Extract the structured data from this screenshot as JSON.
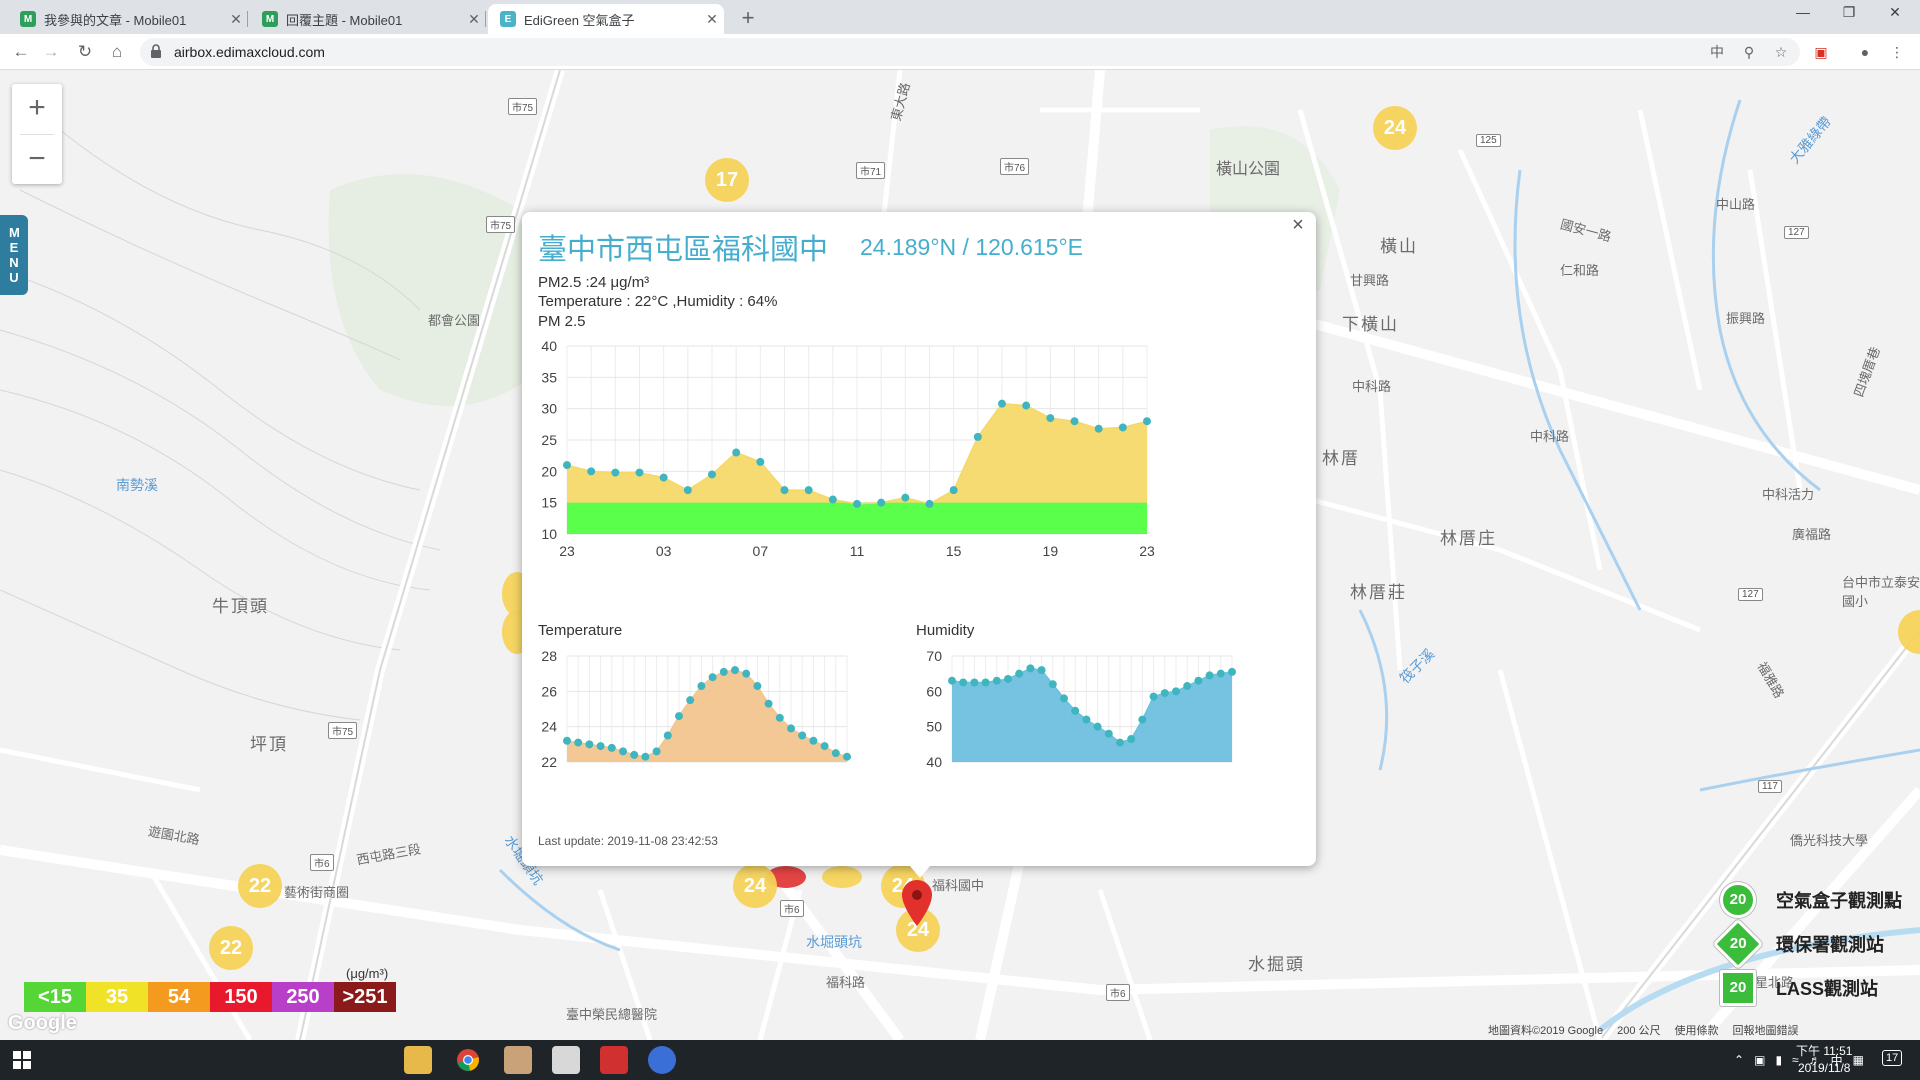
{
  "browser": {
    "tabs": [
      {
        "title": "我參與的文章 - Mobile01",
        "close": "✕"
      },
      {
        "title": "回覆主題 - Mobile01",
        "close": "✕"
      },
      {
        "title": "EdiGreen 空氣盒子",
        "close": "✕"
      }
    ],
    "new_tab": "+",
    "url": "airbox.edimaxcloud.com"
  },
  "map": {
    "zoom_in": "+",
    "zoom_out": "−",
    "menu_label": "MENU",
    "place_labels": [
      "橫山公園",
      "橫山",
      "下橫山",
      "林厝",
      "林厝庄",
      "林厝莊",
      "南勢溪",
      "牛頂頭",
      "坪頂",
      "都會公園",
      "藝術街商圈",
      "水堀頭坑",
      "水掘頭",
      "福科路",
      "中科路",
      "中科路",
      "中科活力",
      "廣福路",
      "台中市立泰安國小",
      "僑光科技大學",
      "福星北路",
      "大雅綠帶",
      "四塊厝巷",
      "臺中榮民總醫院",
      "遊園北路",
      "西屯路三段",
      "福科國中",
      "水堀頭坑",
      "筏子溪",
      "仁和路",
      "振興路",
      "中山路",
      "甘興路",
      "福雅路",
      "國安一路",
      "東大路"
    ],
    "road_tags": [
      "市75",
      "市71",
      "市76",
      "市75",
      "市75",
      "125",
      "127",
      "127",
      "市6",
      "市6",
      "117",
      "市6"
    ],
    "bubbles": [
      "17",
      "24",
      "22",
      "22",
      "24",
      "24",
      "24"
    ]
  },
  "popup": {
    "title": "臺中市西屯區福科國中",
    "coords": "24.189°N / 120.615°E",
    "pm25_line": "PM2.5 :24 μg/m³",
    "temp_hum_line": "Temperature : 22°C ,Humidity : 64%",
    "close": "×",
    "last_update": "Last update: 2019-11-08 23:42:53"
  },
  "chart_data": [
    {
      "type": "area",
      "title": "PM 2.5",
      "x_tick_labels": [
        "23",
        "03",
        "07",
        "11",
        "15",
        "19",
        "23"
      ],
      "ylim": [
        10,
        40
      ],
      "y_ticks": [
        10,
        15,
        20,
        25,
        30,
        35,
        40
      ],
      "series": [
        {
          "values": [
            21,
            20,
            19.8,
            19.8,
            19,
            17,
            19.5,
            23,
            21.5,
            17,
            17,
            15.5,
            14.8,
            15,
            15.8,
            14.8,
            17,
            25.5,
            30.8,
            30.5,
            28.5,
            28,
            26.8,
            27,
            28
          ]
        }
      ],
      "threshold_band": {
        "from": 10,
        "to": 15,
        "color": "#59ff4a"
      },
      "fill_color": "#f5d86a",
      "point_color": "#3fb6bf",
      "grid": true
    },
    {
      "type": "area",
      "title": "Temperature",
      "ylim": [
        22,
        28
      ],
      "y_ticks": [
        22,
        24,
        26,
        28
      ],
      "series": [
        {
          "values": [
            23.2,
            23.1,
            23,
            22.9,
            22.8,
            22.6,
            22.4,
            22.3,
            22.6,
            23.5,
            24.6,
            25.5,
            26.3,
            26.8,
            27.1,
            27.2,
            27,
            26.3,
            25.3,
            24.5,
            23.9,
            23.5,
            23.2,
            22.9,
            22.5,
            22.3
          ]
        }
      ],
      "fill_color": "#f3c58e",
      "point_color": "#3fb6bf",
      "grid": true
    },
    {
      "type": "area",
      "title": "Humidity",
      "ylim": [
        40,
        70
      ],
      "y_ticks": [
        40,
        50,
        60,
        70
      ],
      "series": [
        {
          "values": [
            63,
            62.5,
            62.5,
            62.5,
            63,
            63.5,
            65,
            66.5,
            66,
            62,
            58,
            54.5,
            52,
            50,
            48,
            45.5,
            46.5,
            52,
            58.5,
            59.5,
            60,
            61.5,
            63,
            64.5,
            65,
            65.5
          ]
        }
      ],
      "fill_color": "#6ec0de",
      "point_color": "#3fb6bf",
      "grid": true
    }
  ],
  "legend": {
    "unit": "(μg/m³)",
    "levels": [
      {
        "label": "<15",
        "color": "#56d636"
      },
      {
        "label": "35",
        "color": "#f0e227"
      },
      {
        "label": "54",
        "color": "#f39a1f"
      },
      {
        "label": "150",
        "color": "#e8192c"
      },
      {
        "label": "250",
        "color": "#b83fc8"
      },
      {
        "label": ">251",
        "color": "#8b1a1a"
      }
    ],
    "station_types": [
      {
        "badge": "20",
        "label": "空氣盒子觀測點"
      },
      {
        "badge": "20",
        "label": "環保署觀測站"
      },
      {
        "badge": "20",
        "label": "LASS觀測站"
      }
    ]
  },
  "attribution": {
    "data": "地圖資料©2019 Google",
    "scale": "200 公尺",
    "terms": "使用條款",
    "report": "回報地圖錯誤",
    "logo": "Google"
  },
  "taskbar": {
    "time": "下午 11:51",
    "date": "2019/11/8",
    "ime": "中",
    "notif_count": "17"
  }
}
